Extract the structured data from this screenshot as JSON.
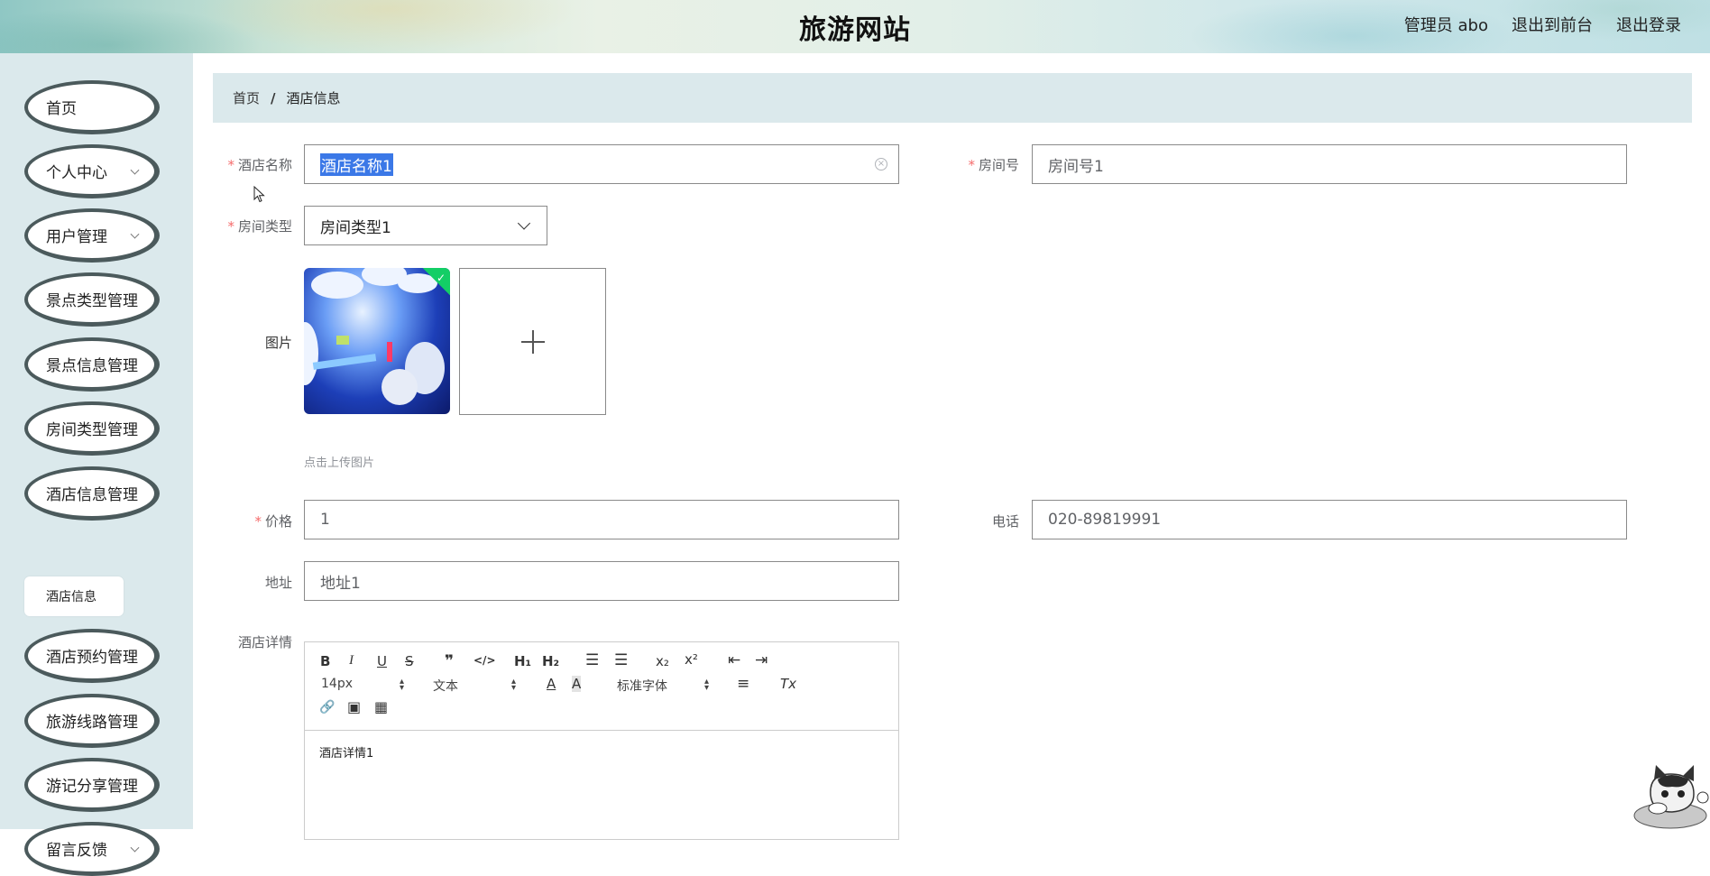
{
  "header": {
    "title": "旅游网站",
    "links": [
      "管理员 abo",
      "退出到前台",
      "退出登录"
    ]
  },
  "sidebar": {
    "items": [
      {
        "label": "首页",
        "has_arrow": false
      },
      {
        "label": "个人中心",
        "has_arrow": true
      },
      {
        "label": "用户管理",
        "has_arrow": true
      },
      {
        "label": "景点类型管理",
        "has_arrow": false
      },
      {
        "label": "景点信息管理",
        "has_arrow": false
      },
      {
        "label": "房间类型管理",
        "has_arrow": false
      },
      {
        "label": "酒店信息管理",
        "has_arrow": false
      },
      {
        "label": "酒店预约管理",
        "has_arrow": false
      },
      {
        "label": "旅游线路管理",
        "has_arrow": false
      },
      {
        "label": "游记分享管理",
        "has_arrow": false
      },
      {
        "label": "留言反馈",
        "has_arrow": true
      }
    ],
    "submenu_active": "酒店信息"
  },
  "breadcrumb": {
    "home": "首页",
    "separator": "/",
    "current": "酒店信息"
  },
  "form": {
    "required_mark": "*",
    "hotel_name": {
      "label": "酒店名称",
      "value": "酒店名称1"
    },
    "room_no": {
      "label": "房间号",
      "value": "房间号1"
    },
    "room_type": {
      "label": "房间类型",
      "value": "房间类型1"
    },
    "image": {
      "label": "图片",
      "hint": "点击上传图片"
    },
    "price": {
      "label": "价格",
      "value": "1"
    },
    "phone": {
      "label": "电话",
      "value": "020-89819991"
    },
    "address": {
      "label": "地址",
      "value": "地址1"
    },
    "details": {
      "label": "酒店详情",
      "content": "酒店详情1"
    }
  },
  "editor": {
    "toolbar": {
      "bold": "B",
      "italic": "I",
      "underline": "U",
      "strike": "S",
      "quote": "❞",
      "code": "</>",
      "h1": "H₁",
      "h2": "H₂",
      "ordered_list": "☰",
      "bullet_list": "☰",
      "subscript": "x₂",
      "superscript": "x²",
      "outdent": "⇤",
      "indent": "⇥",
      "size": "14px",
      "format": "文本",
      "font": "标准字体",
      "color": "A",
      "background": "A",
      "align": "≡",
      "clear": "Tx",
      "link": "🔗",
      "image": "▣",
      "video": "▦"
    }
  },
  "colors": {
    "sidebar_bg": "#dbe9ec",
    "menu_border": "#4b5a5c",
    "required": "#f56c6c",
    "selection": "#3b78e7",
    "upload_success": "#13ce66"
  }
}
